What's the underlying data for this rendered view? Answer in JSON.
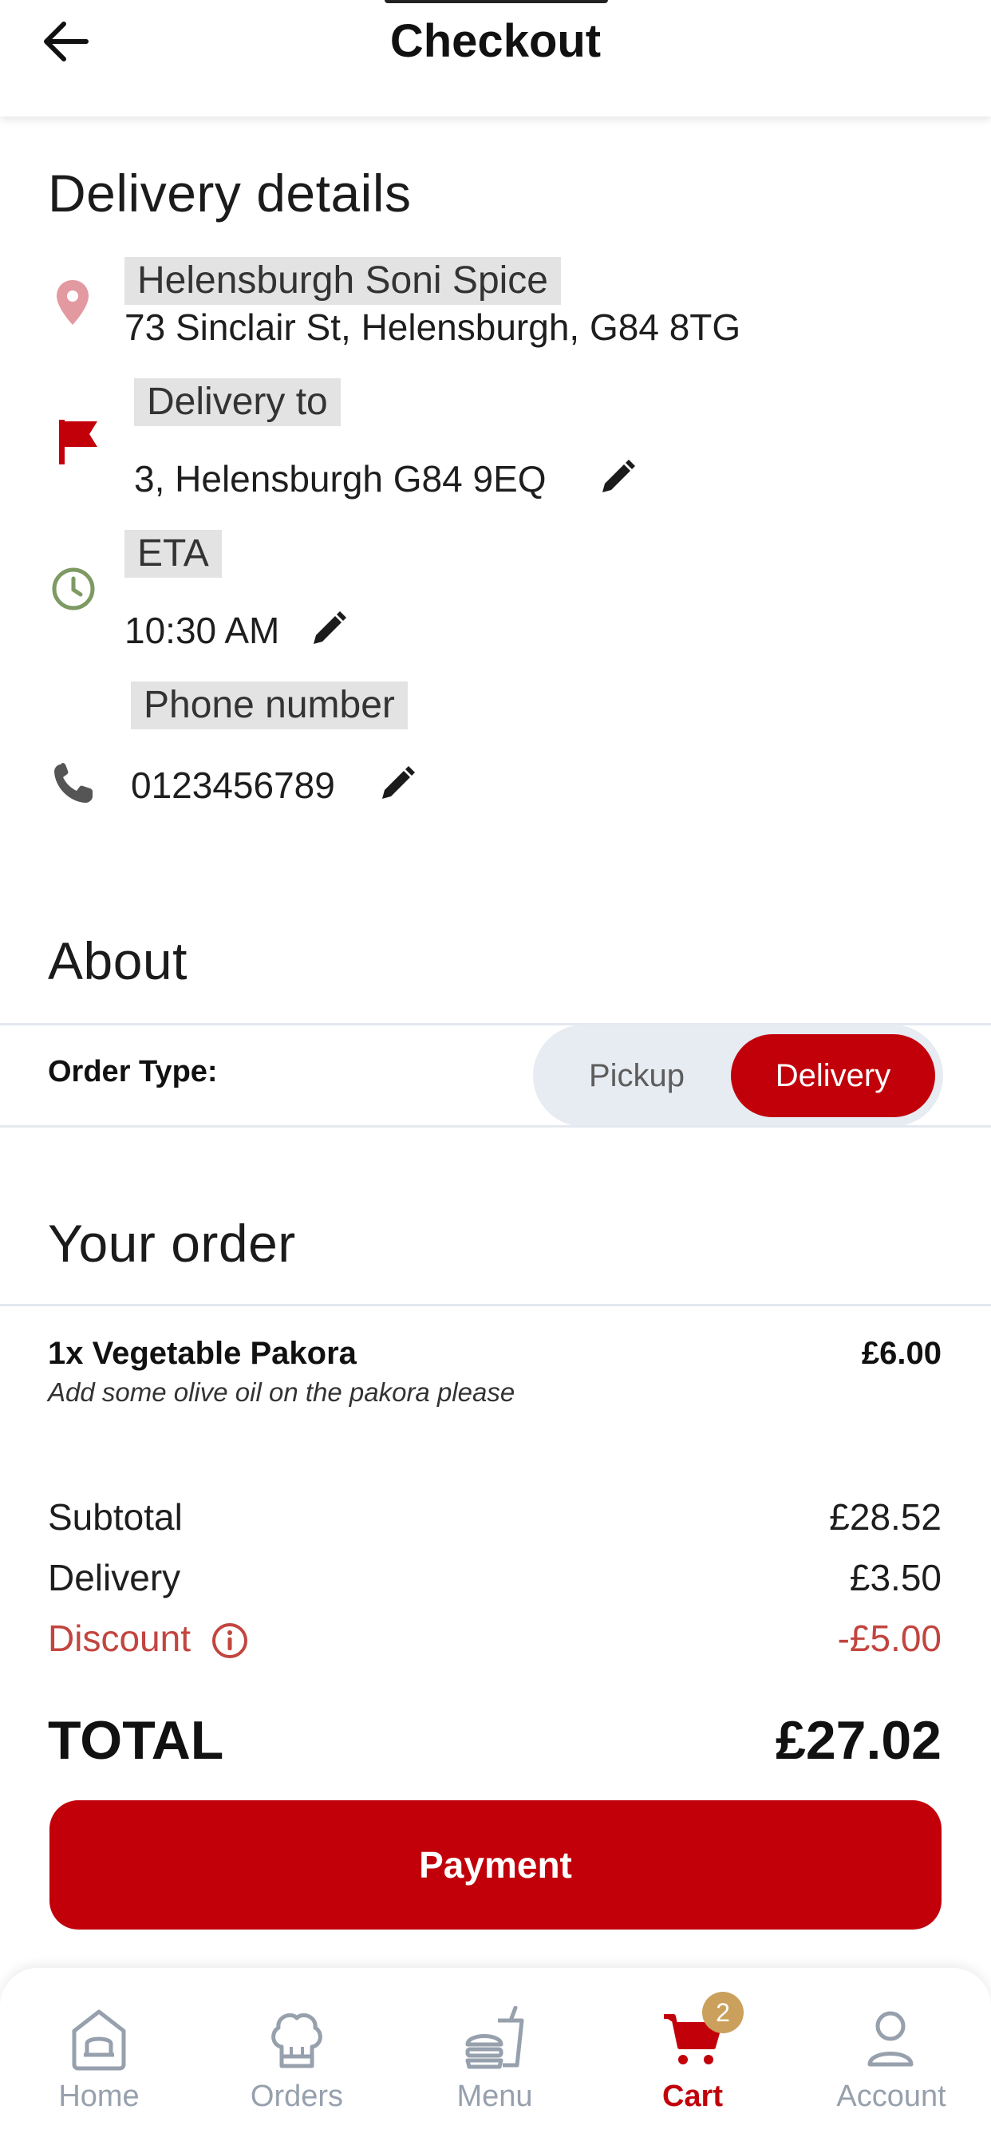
{
  "header": {
    "title": "Checkout"
  },
  "delivery_details": {
    "title": "Delivery details",
    "restaurant": {
      "name": "Helensburgh Soni Spice",
      "address": "73 Sinclair St, Helensburgh, G84 8TG"
    },
    "delivery_to": {
      "label": "Delivery to",
      "value": "3, Helensburgh G84 9EQ"
    },
    "eta": {
      "label": "ETA",
      "value": "10:30 AM"
    },
    "phone": {
      "label": "Phone number",
      "value": "0123456789"
    }
  },
  "about": {
    "title": "About",
    "order_type_label": "Order Type:",
    "options": [
      "Pickup",
      "Delivery"
    ],
    "selected": "Delivery"
  },
  "order": {
    "title": "Your order",
    "items": [
      {
        "title": "1x Vegetable Pakora",
        "price": "£6.00",
        "note": "Add some olive oil on the pakora please"
      }
    ],
    "subtotal_label": "Subtotal",
    "subtotal": "£28.52",
    "delivery_label": "Delivery",
    "delivery": "£3.50",
    "discount_label": "Discount",
    "discount": "-£5.00",
    "total_label": "TOTAL",
    "total": "£27.02"
  },
  "payment_button": "Payment",
  "nav": {
    "items": [
      {
        "label": "Home",
        "icon": "home-icon"
      },
      {
        "label": "Orders",
        "icon": "chef-hat-icon"
      },
      {
        "label": "Menu",
        "icon": "burger-drink-icon"
      },
      {
        "label": "Cart",
        "icon": "cart-icon"
      },
      {
        "label": "Account",
        "icon": "user-icon"
      }
    ],
    "active": "Cart",
    "cart_badge": "2"
  },
  "colors": {
    "accent": "#c1000a",
    "discount": "#c2453f",
    "badge": "#caa05c",
    "inactive_nav": "#97a0ad"
  }
}
